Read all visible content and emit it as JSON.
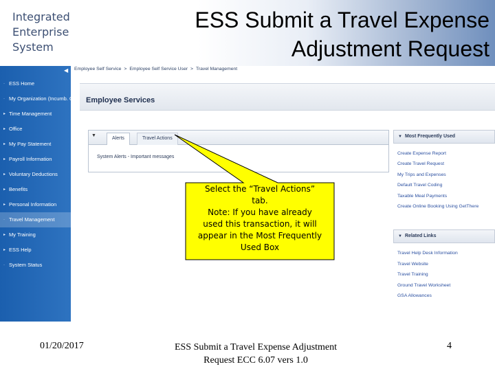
{
  "brand": {
    "lines": [
      "Integrated",
      "Enterprise",
      "System"
    ]
  },
  "slide_title": {
    "line1": "ESS Submit a Travel Expense",
    "line2": "Adjustment Request"
  },
  "app": {
    "breadcrumb": [
      "Employee Self Service",
      "Employee Self Service User",
      "Travel Management"
    ],
    "breadcrumb_sep": ">",
    "collapse_icon": "chevron-left-icon",
    "sidebar": [
      {
        "label": "ESS Home",
        "marker": "·",
        "active": false
      },
      {
        "label": "My Organization (Incumb. Only)",
        "marker": "·",
        "active": false
      },
      {
        "label": "Time Management",
        "marker": "▸",
        "active": false
      },
      {
        "label": "Office",
        "marker": "▸",
        "active": false
      },
      {
        "label": "My Pay Statement",
        "marker": "▸",
        "active": false
      },
      {
        "label": "Payroll Information",
        "marker": "▸",
        "active": false
      },
      {
        "label": "Voluntary Deductions",
        "marker": "▸",
        "active": false
      },
      {
        "label": "Benefits",
        "marker": "▸",
        "active": false
      },
      {
        "label": "Personal Information",
        "marker": "▸",
        "active": false
      },
      {
        "label": "Travel Management",
        "marker": "·",
        "active": true
      },
      {
        "label": "My Training",
        "marker": "▸",
        "active": false
      },
      {
        "label": "ESS Help",
        "marker": "▸",
        "active": false
      },
      {
        "label": "System Status",
        "marker": "·",
        "active": false
      }
    ],
    "employee_services_title": "Employee Services",
    "alerts_panel": {
      "tabs": [
        "Alerts",
        "Travel Actions"
      ],
      "body": "System Alerts - Important messages"
    },
    "most_frequently_used": {
      "title": "Most Frequently Used",
      "links": [
        "Create Expense Report",
        "Create Travel Request",
        "My Trips and Expenses",
        "Default Travel Coding",
        "Taxable Meal Payments",
        "Create Online Booking Using GetThere"
      ]
    },
    "related_links": {
      "title": "Related Links",
      "links": [
        "Travel Help Desk Information",
        "Travel Website",
        "Travel Training",
        "Ground Travel Worksheet",
        "GSA Allowances"
      ]
    }
  },
  "callout": {
    "lines": [
      "Select the “Travel Actions”",
      "tab.",
      "Note:  If you have already",
      "used this transaction, it will",
      "appear in the Most Frequently",
      "Used Box"
    ],
    "fill": "#ffff00"
  },
  "footer": {
    "date": "01/20/2017",
    "center_line1": "ESS Submit a Travel Expense Adjustment",
    "center_line2": "Request ECC 6.07 vers 1.0",
    "page": "4"
  }
}
